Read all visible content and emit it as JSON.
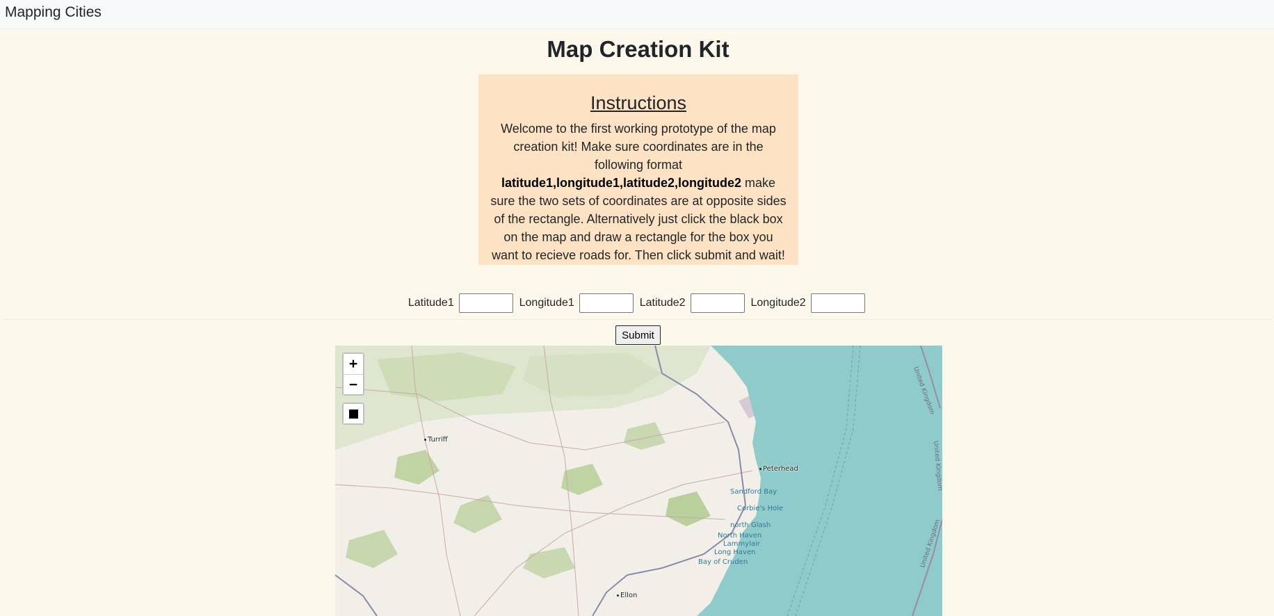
{
  "navbar": {
    "brand": "Mapping Cities"
  },
  "page_title": "Map Creation Kit",
  "instructions": {
    "heading": "Instructions",
    "text_before": "Welcome to the first working prototype of the map creation kit! Make sure coordinates are in the following format ",
    "format": "latitude1,longitude1,latitude2,longitude2",
    "text_after": " make sure the two sets of coordinates are at opposite sides of the rectangle. Alternatively just click the black box on the map and draw a rectangle for the box you want to recieve roads for. Then click submit and wait!"
  },
  "form": {
    "fields": [
      {
        "label": "Latitude1",
        "value": ""
      },
      {
        "label": "Longitude1",
        "value": ""
      },
      {
        "label": "Latitude2",
        "value": ""
      },
      {
        "label": "Longitude2",
        "value": ""
      }
    ],
    "submit_label": "Submit"
  },
  "map": {
    "controls": {
      "zoom_in": "+",
      "zoom_out": "−",
      "draw_rectangle_icon": "square-icon"
    },
    "towns": [
      "Turriff",
      "Peterhead",
      "Ellon"
    ],
    "coastal_labels": [
      "Sandford Bay",
      "Corbie's Hole",
      "north Glash",
      "North Haven",
      "Lammylair",
      "Long Haven",
      "Bay of Cruden"
    ],
    "border_labels": [
      "United Kingdom",
      "United Kingdom",
      "United Kingdom"
    ],
    "colors": {
      "sea": "#8fcbcb",
      "land": "#f2efe8",
      "woodland": "#c9d8b0",
      "road": "#c9a8a8",
      "major_road": "#8a8aa8"
    }
  }
}
